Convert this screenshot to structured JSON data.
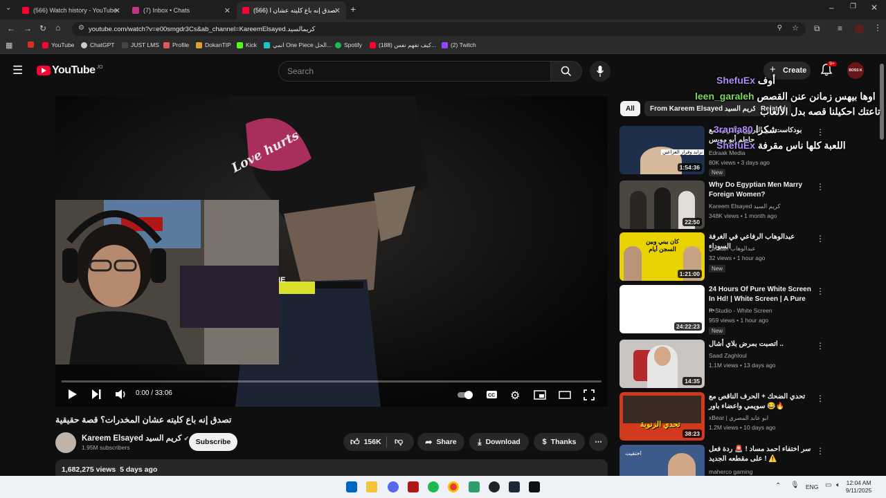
{
  "browser": {
    "tabs": [
      {
        "label": "(566) Watch history - YouTube",
        "color": "#ff0033"
      },
      {
        "label": "(7) Inbox • Chats",
        "color": "#c13584"
      },
      {
        "label": "(566) تصدق إنه باع كليته عشان ا...",
        "color": "#ff0033"
      }
    ],
    "url": "youtube.com/watch?v=e00smgdr3Cs&ab_channel=KareemElsayed.كريمالسيد",
    "bookmarks": [
      "YouTube",
      "ChatGPT",
      "JUST LMS",
      "Profile",
      "DokanTIP",
      "Kick",
      "انمي One Piece الحل...",
      "Spotify",
      "(188) كيف تفهم نفس...",
      "(2) Twitch"
    ]
  },
  "youtube": {
    "logo": "YouTube",
    "region": "JO",
    "search_placeholder": "Search",
    "create_label": "Create",
    "notif_count": "9+",
    "avatar_text": "BOSS K",
    "player": {
      "time": "0:00 / 33:06",
      "video_text": "Love hurts",
      "belt_text": "AME"
    },
    "video": {
      "title": "تصدق إنه باع كليته عشان المخدرات؟ قصة حقيقية",
      "channel": "Kareem Elsayed كريم السيد",
      "subscribers": "1.95M subscribers",
      "subscribe_label": "Subscribe",
      "likes": "156K",
      "share_label": "Share",
      "download_label": "Download",
      "thanks_label": "Thanks",
      "views": "1,682,275 views",
      "age": "5 days ago"
    },
    "chips": [
      "All",
      "From Kareem Elsayed كريم السيد",
      "Related"
    ],
    "related": [
      {
        "title": "بودكاست بين الترويح والترفيه مع حاطم أبو مويس",
        "channel": "Edraak Media",
        "meta": "80K views • 3 days ago",
        "badge": "New",
        "duration": "1:54:36",
        "thumb_text": "تزايد وقرار العزاعين",
        "thumb_color": "#1d2f4a"
      },
      {
        "title": "Why Do Egyptian Men Marry Foreign Women?",
        "channel": "Kareem Elsayed كريم السيد",
        "meta": "348K views • 1 month ago",
        "badge": "",
        "duration": "22:50",
        "thumb_text": "",
        "thumb_color": "#4a4640"
      },
      {
        "title": "عبدالوهاب الرفاعي في الغرفة السوداء",
        "channel": "عبدالوهاب أشكناني",
        "meta": "32 views • 1 hour ago",
        "badge": "New",
        "duration": "1:21:00",
        "thumb_text": "كان بيني وبين السجن أيام",
        "thumb_color": "#e8d200"
      },
      {
        "title": "24 Hours Of Pure White Screen In Hd! | White Screen | A Pure ...",
        "channel": "R-Studio - White Screen",
        "meta": "959 views • 1 hour ago",
        "badge": "New",
        "duration": "24:22:23",
        "thumb_text": "",
        "thumb_color": "#ffffff"
      },
      {
        "title": "اتصبت بمرض بلاي أشال ..",
        "channel": "Saad Zaghloul",
        "meta": "1.1M views • 13 days ago",
        "badge": "",
        "duration": "14:35",
        "thumb_text": "",
        "thumb_color": "#c9c4bf"
      },
      {
        "title": "تحدي الضحك + الحرف الناقص مع سويمي واعضاء باور 😂🔥",
        "channel": "xBear | ابو عابد المصري",
        "meta": "1.2M views • 10 days ago",
        "badge": "",
        "duration": "38:23",
        "thumb_text": "تحدي الزنوبة",
        "thumb_color": "#d23a1e"
      },
      {
        "title": "سر اختفاء احمد مساد ! 🚨 ردة فعل على مقطعه الجديد ! ⚠️",
        "channel": "maherco gaming",
        "meta": "",
        "badge": "",
        "duration": "",
        "thumb_text": "اختفيت",
        "thumb_color": "#3c5a8a"
      }
    ]
  },
  "chat_overlay": [
    {
      "user": "ShefuEx",
      "msg": "أوف",
      "color": "#b388ff"
    },
    {
      "user": "leen_garaleh",
      "msg": "اوها بيهس زمانن عنن القصص",
      "color": "#7cd85f"
    },
    {
      "user": "",
      "msg": "تاعتك احكيلنا قصه بدل الألعاب",
      "color": "#ffffff"
    },
    {
      "user": "3rania80",
      "msg": "شكرا",
      "color": "#b388ff"
    },
    {
      "user": "ShefuEx",
      "msg": "اللعبة كلها ناس مقرفة",
      "color": "#b388ff"
    }
  ],
  "taskbar": {
    "lang": "ENG",
    "time": "12:04 AM",
    "date": "9/11/2025"
  }
}
